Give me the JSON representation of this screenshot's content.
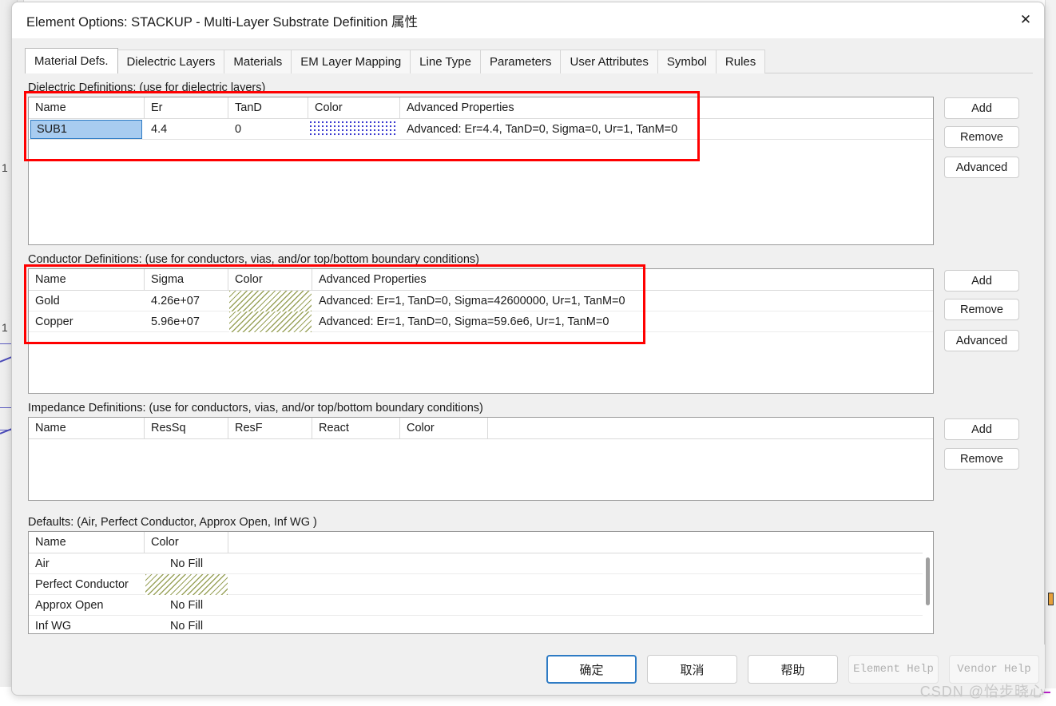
{
  "window": {
    "title": "Element Options: STACKUP - Multi-Layer Substrate Definition 属性",
    "close_icon": "close-icon"
  },
  "tabs": [
    {
      "label": "Material Defs.",
      "active": true
    },
    {
      "label": "Dielectric Layers",
      "active": false
    },
    {
      "label": "Materials",
      "active": false
    },
    {
      "label": "EM Layer Mapping",
      "active": false
    },
    {
      "label": "Line Type",
      "active": false
    },
    {
      "label": "Parameters",
      "active": false
    },
    {
      "label": "User Attributes",
      "active": false
    },
    {
      "label": "Symbol",
      "active": false
    },
    {
      "label": "Rules",
      "active": false
    }
  ],
  "dielectric": {
    "label": "Dielectric Definitions: (use for dielectric layers)",
    "columns": [
      "Name",
      "Er",
      "TanD",
      "Color",
      "Advanced Properties"
    ],
    "rows": [
      {
        "name": "SUB1",
        "er": "4.4",
        "tand": "0",
        "color_swatch": "blue-dotted-pattern",
        "advanced": "Advanced: Er=4.4, TanD=0, Sigma=0, Ur=1, TanM=0",
        "selected": true
      }
    ],
    "buttons": [
      "Add",
      "Remove",
      "Advanced"
    ]
  },
  "conductor": {
    "label": "Conductor  Definitions: (use for conductors, vias, and/or top/bottom boundary conditions)",
    "columns": [
      "Name",
      "Sigma",
      "Color",
      "Advanced Properties"
    ],
    "rows": [
      {
        "name": "Gold",
        "sigma": "4.26e+07",
        "color_swatch": "olive-diagonal-hatch",
        "advanced": "Advanced: Er=1, TanD=0, Sigma=42600000, Ur=1, TanM=0"
      },
      {
        "name": "Copper",
        "sigma": "5.96e+07",
        "color_swatch": "olive-diagonal-hatch",
        "advanced": "Advanced: Er=1, TanD=0, Sigma=59.6e6, Ur=1, TanM=0"
      }
    ],
    "buttons": [
      "Add",
      "Remove",
      "Advanced"
    ]
  },
  "impedance": {
    "label": "Impedance  Definitions: (use for conductors, vias, and/or top/bottom boundary conditions)",
    "columns": [
      "Name",
      "ResSq",
      "ResF",
      "React",
      "Color"
    ],
    "rows": [],
    "buttons": [
      "Add",
      "Remove"
    ]
  },
  "defaults": {
    "label": "Defaults:  (Air, Perfect Conductor, Approx Open, Inf WG  )",
    "columns": [
      "Name",
      "Color"
    ],
    "rows": [
      {
        "name": "Air",
        "color": "No Fill",
        "swatch": null
      },
      {
        "name": "Perfect Conductor",
        "color": "",
        "swatch": "olive-diagonal-hatch"
      },
      {
        "name": "Approx Open",
        "color": "No Fill",
        "swatch": null
      },
      {
        "name": "Inf WG",
        "color": "No Fill",
        "swatch": null
      }
    ]
  },
  "footer": {
    "ok": "确定",
    "cancel": "取消",
    "help": "帮助",
    "element_help": "Element Help",
    "vendor_help": "Vendor Help"
  },
  "watermark": "CSDN @怡步晓心",
  "background_fragments": {
    "left_1": "1",
    "left_2": "1"
  },
  "colors": {
    "accent": "#2e7bc4",
    "selection": "#a8ccf0",
    "annotation": "#ff0000",
    "dielectric_swatch": "#3a3ad0",
    "conductor_swatch": "#9aa35c",
    "watermark": "#c7c7c7"
  }
}
